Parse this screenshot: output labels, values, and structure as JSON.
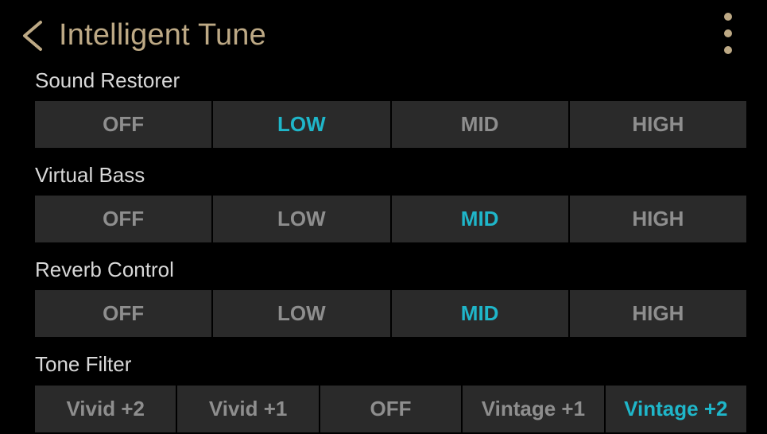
{
  "header": {
    "title": "Intelligent Tune",
    "back_icon": "chevron-left-icon",
    "menu_icon": "more-vertical-icon"
  },
  "colors": {
    "accent": "#1fb6c9",
    "title": "#bda985",
    "segment_bg": "#2a2a2a",
    "segment_text": "#8e8e8e",
    "label_text": "#d8d8d8"
  },
  "sections": [
    {
      "label": "Sound Restorer",
      "options": [
        "OFF",
        "LOW",
        "MID",
        "HIGH"
      ],
      "selected": "LOW"
    },
    {
      "label": "Virtual Bass",
      "options": [
        "OFF",
        "LOW",
        "MID",
        "HIGH"
      ],
      "selected": "MID"
    },
    {
      "label": "Reverb Control",
      "options": [
        "OFF",
        "LOW",
        "MID",
        "HIGH"
      ],
      "selected": "MID"
    },
    {
      "label": "Tone Filter",
      "options": [
        "Vivid +2",
        "Vivid +1",
        "OFF",
        "Vintage +1",
        "Vintage +2"
      ],
      "selected": "Vintage +2"
    }
  ]
}
